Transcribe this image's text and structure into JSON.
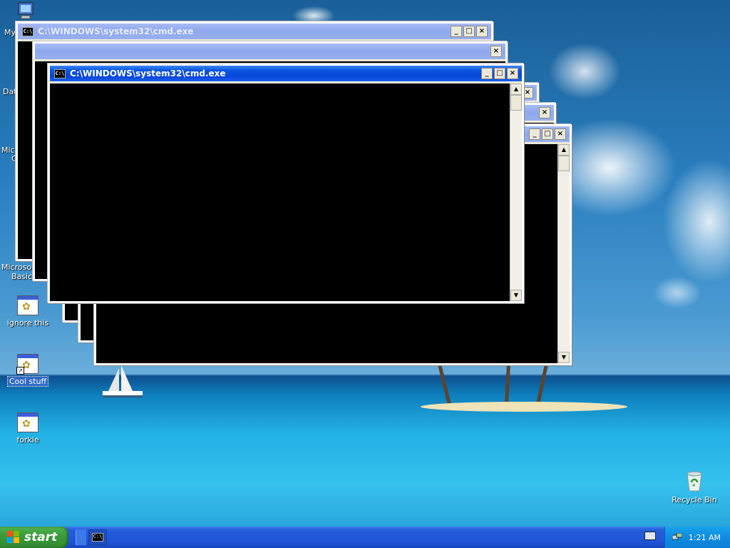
{
  "desktop": {
    "icons": [
      {
        "label": "ignore this"
      },
      {
        "label": "Cool stuff"
      },
      {
        "label": "forkie"
      },
      {
        "label": "Recycle Bin"
      }
    ],
    "partial_labels": [
      "My",
      "Dat",
      "Micro",
      "C",
      "Microsoft",
      "Basic"
    ]
  },
  "windows": {
    "cmd_title": "C:\\WINDOWS\\system32\\cmd.exe",
    "minimize_glyph": "_",
    "maximize_glyph": "□",
    "close_glyph": "×",
    "scroll_up_glyph": "▲",
    "scroll_down_glyph": "▼",
    "app_icon_glyph": "C:\\"
  },
  "taskbar": {
    "start_label": "start",
    "clock": "1:21 AM"
  }
}
